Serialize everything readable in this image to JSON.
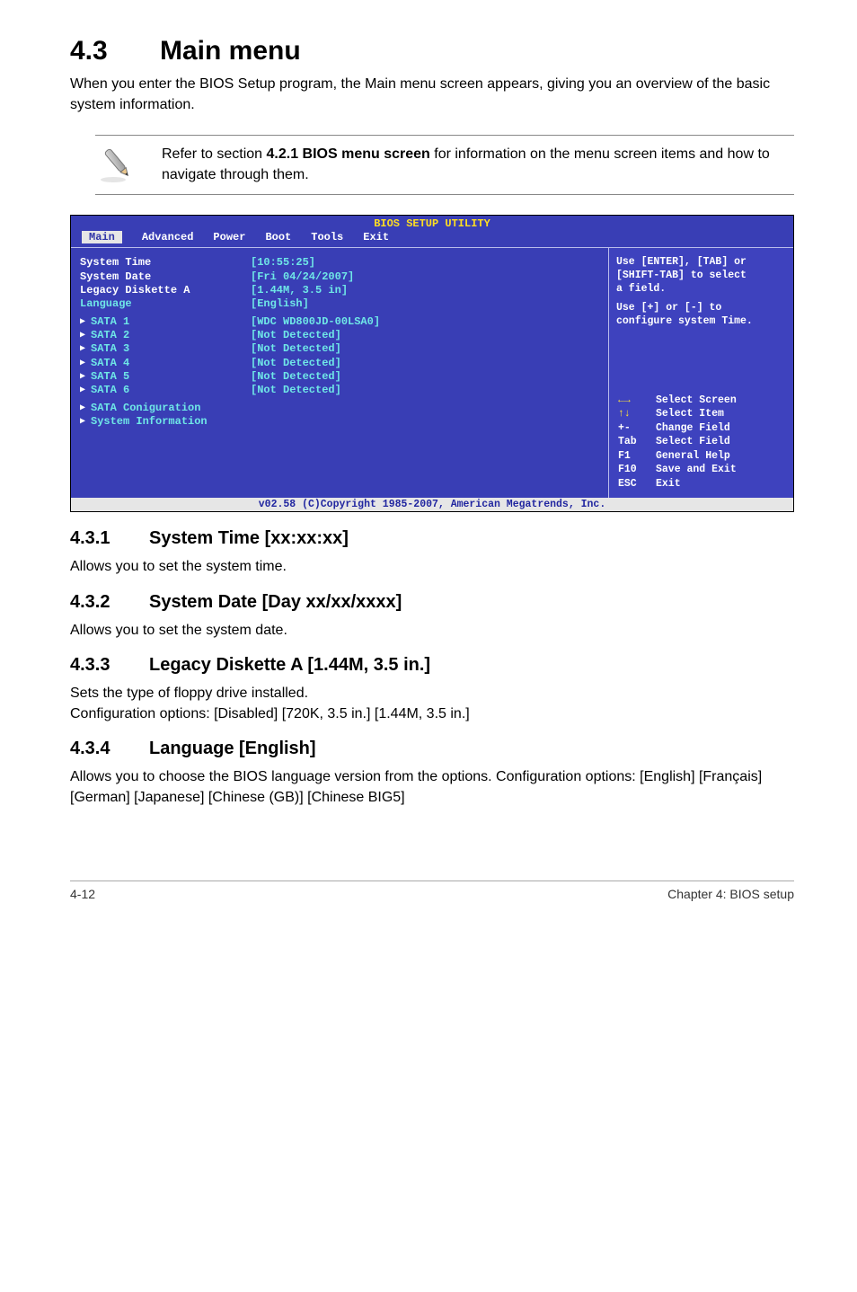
{
  "h1_num": "4.3",
  "h1_title": "Main menu",
  "intro": "When you enter the BIOS Setup program, the Main menu screen appears, giving you an overview of the basic system information.",
  "note_pre": "Refer to section ",
  "note_bold": "4.2.1  BIOS menu screen",
  "note_post": " for information on the menu screen items and how to navigate through them.",
  "bios": {
    "title": "BIOS SETUP UTILITY",
    "tabs": [
      "Main",
      "Advanced",
      "Power",
      "Boot",
      "Tools",
      "Exit"
    ],
    "rows": [
      {
        "label": "System Time",
        "value": "[10:55:25]",
        "cyan": false,
        "tri": false
      },
      {
        "label": "System Date",
        "value": "[Fri 04/24/2007]",
        "cyan": false,
        "tri": false
      },
      {
        "label": "Legacy Diskette A",
        "value": "[1.44M, 3.5 in]",
        "cyan": false,
        "tri": false
      },
      {
        "label": "Language",
        "value": "[English]",
        "cyan": false,
        "tri": false
      }
    ],
    "sata": [
      {
        "label": "SATA 1",
        "value": "[WDC WD800JD-00LSA0]"
      },
      {
        "label": "SATA 2",
        "value": "[Not Detected]"
      },
      {
        "label": "SATA 3",
        "value": "[Not Detected]"
      },
      {
        "label": "SATA 4",
        "value": "[Not Detected]"
      },
      {
        "label": "SATA 5",
        "value": "[Not Detected]"
      },
      {
        "label": "SATA 6",
        "value": "[Not Detected]"
      }
    ],
    "extra": [
      "SATA Coniguration",
      "System Information"
    ],
    "help1a": "Use [ENTER], [TAB] or",
    "help1b": "[SHIFT-TAB] to select",
    "help1c": "a field.",
    "help2a": "Use [+] or [-] to",
    "help2b": "configure system Time.",
    "keys": [
      {
        "sym": "←→",
        "txt": "Select Screen"
      },
      {
        "sym": "↑↓",
        "txt": "Select Item"
      },
      {
        "sym": "+-",
        "txt": "Change Field"
      },
      {
        "sym": "Tab",
        "txt": "Select Field"
      },
      {
        "sym": "F1",
        "txt": "General Help"
      },
      {
        "sym": "F10",
        "txt": "Save and Exit"
      },
      {
        "sym": "ESC",
        "txt": "Exit"
      }
    ],
    "footer": "v02.58 (C)Copyright 1985-2007, American Megatrends, Inc."
  },
  "s1_num": "4.3.1",
  "s1_title": "System Time [xx:xx:xx]",
  "s1_body": "Allows you to set the system time.",
  "s2_num": "4.3.2",
  "s2_title": "System Date [Day xx/xx/xxxx]",
  "s2_body": "Allows you to set the system date.",
  "s3_num": "4.3.3",
  "s3_title": "Legacy Diskette A [1.44M, 3.5 in.]",
  "s3_body1": "Sets the type of floppy drive installed.",
  "s3_body2": "Configuration options: [Disabled] [720K, 3.5 in.] [1.44M, 3.5 in.]",
  "s4_num": "4.3.4",
  "s4_title": "Language [English]",
  "s4_body": "Allows you to choose the BIOS language version from the options. Configuration options: [English] [Français] [German] [Japanese] [Chinese (GB)] [Chinese BIG5]",
  "foot_left": "4-12",
  "foot_right": "Chapter 4: BIOS setup"
}
